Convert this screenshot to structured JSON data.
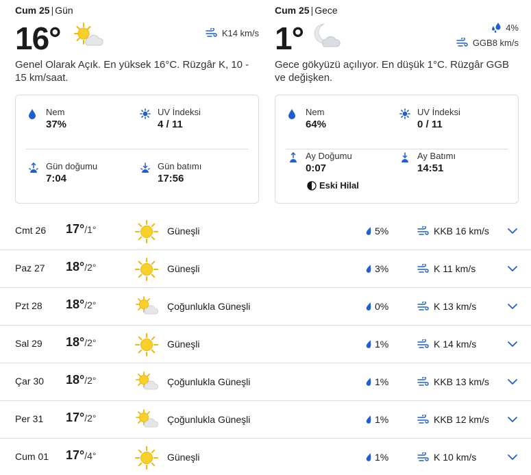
{
  "day": {
    "date": "Cum 25",
    "period": "Gün",
    "temp": "16°",
    "wind": "K14 km/s",
    "description": "Genel Olarak Açık. En yüksek 16°C. Rüzgâr K, 10 - 15 km/saat.",
    "humidity_label": "Nem",
    "humidity": "37%",
    "uv_label": "UV İndeksi",
    "uv": "4 / 11",
    "sunrise_label": "Gün doğumu",
    "sunrise": "7:04",
    "sunset_label": "Gün batımı",
    "sunset": "17:56"
  },
  "night": {
    "date": "Cum 25",
    "period": "Gece",
    "temp": "1°",
    "precip": "4%",
    "wind": "GGB8 km/s",
    "description": "Gece gökyüzü açılıyor. En düşük 1°C. Rüzgâr GGB ve değişken.",
    "humidity_label": "Nem",
    "humidity": "64%",
    "uv_label": "UV İndeksi",
    "uv": "0 / 11",
    "moonrise_label": "Ay Doğumu",
    "moonrise": "0:07",
    "moonset_label": "Ay Batımı",
    "moonset": "14:51",
    "moon_phase": "Eski Hilal"
  },
  "forecast": [
    {
      "day": "Cmt 26",
      "high": "17°",
      "low": "/1°",
      "icon": "sun-icon",
      "condition": "Güneşli",
      "precip": "5%",
      "wind": "KKB 16 km/s"
    },
    {
      "day": "Paz 27",
      "high": "18°",
      "low": "/2°",
      "icon": "sun-icon",
      "condition": "Güneşli",
      "precip": "3%",
      "wind": "K 11 km/s"
    },
    {
      "day": "Pzt 28",
      "high": "18°",
      "low": "/2°",
      "icon": "mostly-sunny-icon",
      "condition": "Çoğunlukla Güneşli",
      "precip": "0%",
      "wind": "K 13 km/s"
    },
    {
      "day": "Sal 29",
      "high": "18°",
      "low": "/2°",
      "icon": "sun-icon",
      "condition": "Güneşli",
      "precip": "1%",
      "wind": "K 14 km/s"
    },
    {
      "day": "Çar 30",
      "high": "18°",
      "low": "/2°",
      "icon": "mostly-sunny-icon",
      "condition": "Çoğunlukla Güneşli",
      "precip": "1%",
      "wind": "KKB 13 km/s"
    },
    {
      "day": "Per 31",
      "high": "17°",
      "low": "/2°",
      "icon": "mostly-sunny-icon",
      "condition": "Çoğunlukla Güneşli",
      "precip": "1%",
      "wind": "KKB 12 km/s"
    },
    {
      "day": "Cum 01",
      "high": "17°",
      "low": "/4°",
      "icon": "sun-icon",
      "condition": "Güneşli",
      "precip": "1%",
      "wind": "K 10 km/s"
    }
  ],
  "colors": {
    "accent": "#1f5fd1",
    "sun": "#f5c518",
    "cloud": "#cfd3d8",
    "divider": "#dcdcdc"
  }
}
